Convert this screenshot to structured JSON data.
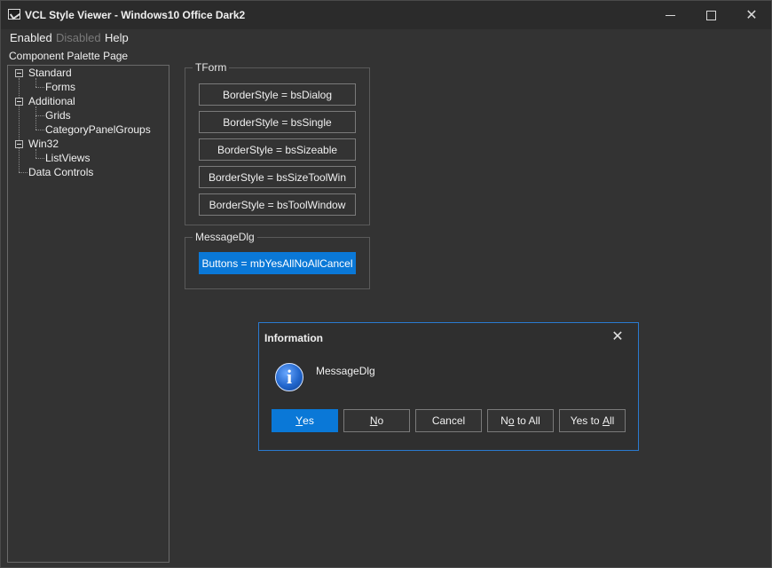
{
  "window": {
    "title": "VCL Style Viewer - Windows10 Office Dark2",
    "controls": {
      "minimize": "—",
      "maximize": "☐",
      "close": "✕"
    }
  },
  "menu": {
    "items": [
      "Enabled",
      "Disabled",
      "Help"
    ]
  },
  "palette": {
    "label": "Component Palette Page",
    "tree": {
      "standard": "Standard",
      "forms": "Forms",
      "additional": "Additional",
      "grids": "Grids",
      "category_panel_groups": "CategoryPanelGroups",
      "win32": "Win32",
      "listviews": "ListViews",
      "data_controls": "Data Controls"
    }
  },
  "tform": {
    "title": "TForm",
    "buttons": [
      "BorderStyle = bsDialog",
      "BorderStyle = bsSingle",
      "BorderStyle = bsSizeable",
      "BorderStyle = bsSizeToolWin",
      "BorderStyle = bsToolWindow"
    ]
  },
  "messagedlg": {
    "title": "MessageDlg",
    "button": "Buttons = mbYesAllNoAllCancel"
  },
  "dialog": {
    "title": "Information",
    "close": "✕",
    "icon": "information-icon",
    "icon_glyph": "i",
    "message": "MessageDlg",
    "buttons": {
      "yes_prefix": "",
      "yes_underline": "Y",
      "yes_suffix": "es",
      "no_prefix": "",
      "no_underline": "N",
      "no_suffix": "o",
      "cancel": "Cancel",
      "no_to_all_prefix": "N",
      "no_to_all_underline": "o",
      "no_to_all_suffix": " to All",
      "yes_to_all_prefix": "Yes to ",
      "yes_to_all_underline": "A",
      "yes_to_all_suffix": "ll"
    }
  },
  "colors": {
    "accent": "#0a78d7",
    "background": "#333333",
    "dialog_border": "#2a7ad0"
  }
}
